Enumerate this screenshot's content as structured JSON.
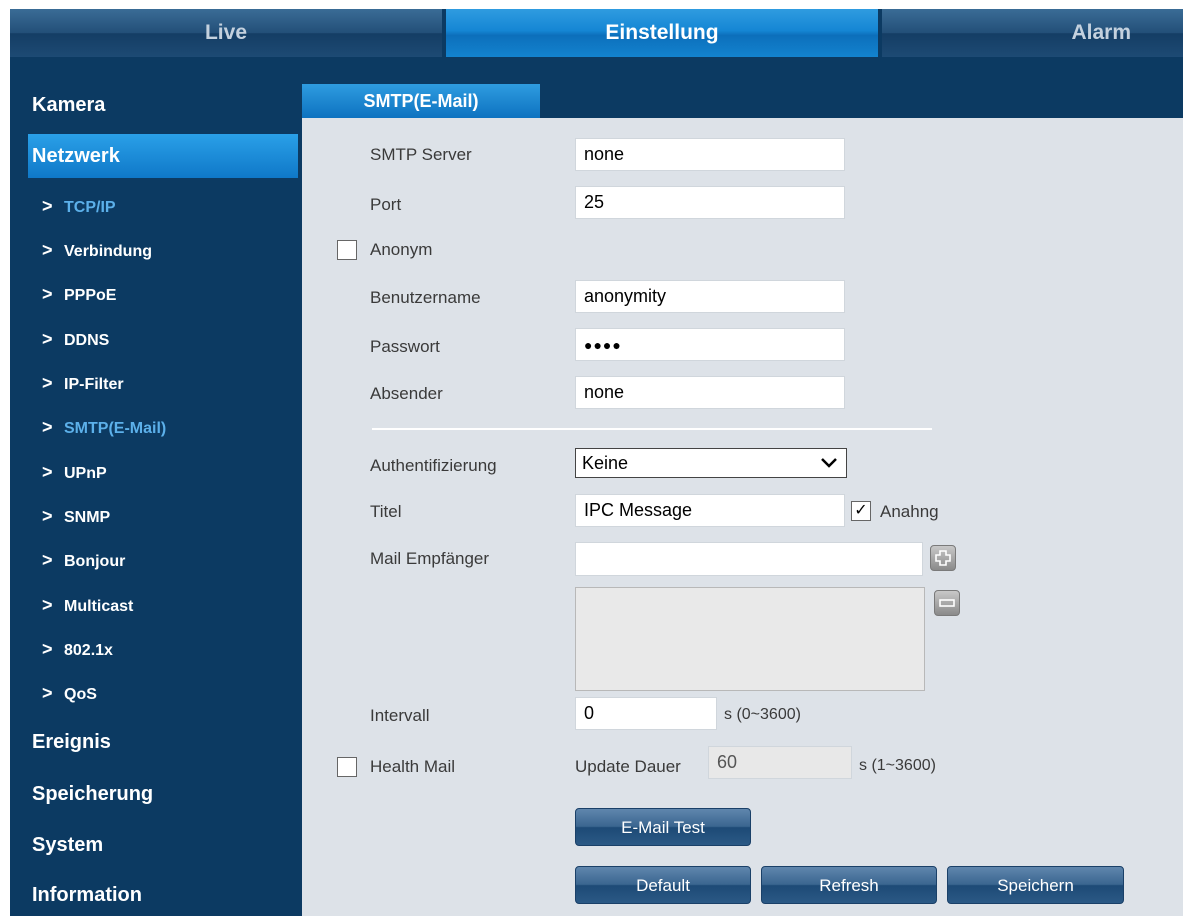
{
  "topnav": {
    "tabs": [
      "Live",
      "Einstellung",
      "Alarm"
    ]
  },
  "sidebar": {
    "sections": [
      "Kamera",
      "Netzwerk",
      "Ereignis",
      "Speicherung",
      "System",
      "Information"
    ],
    "subitems": [
      "TCP/IP",
      "Verbindung",
      "PPPoE",
      "DDNS",
      "IP-Filter",
      "SMTP(E-Mail)",
      "UPnP",
      "SNMP",
      "Bonjour",
      "Multicast",
      "802.1x",
      "QoS"
    ]
  },
  "main": {
    "tab": "SMTP(E-Mail)",
    "smtp_server": {
      "label": "SMTP Server",
      "value": "none"
    },
    "port": {
      "label": "Port",
      "value": "25"
    },
    "anonym": {
      "label": "Anonym",
      "checked": false
    },
    "username": {
      "label": "Benutzername",
      "value": "anonymity"
    },
    "password": {
      "label": "Passwort",
      "value": "●●●●"
    },
    "sender": {
      "label": "Absender",
      "value": "none"
    },
    "auth": {
      "label": "Authentifizierung",
      "value": "Keine"
    },
    "title": {
      "label": "Titel",
      "value": "IPC Message"
    },
    "attachment": {
      "label": "Anahng",
      "checked": true,
      "mark": "✓"
    },
    "recipient": {
      "label": "Mail Empfänger",
      "value": ""
    },
    "interval": {
      "label": "Intervall",
      "value": "0",
      "unit": "s (0~3600)"
    },
    "health_mail": {
      "label": "Health Mail",
      "checked": false
    },
    "update": {
      "label": "Update Dauer",
      "value": "60",
      "unit": "s (1~3600)"
    },
    "buttons": {
      "test": "E-Mail Test",
      "default": "Default",
      "refresh": "Refresh",
      "save": "Speichern"
    }
  }
}
